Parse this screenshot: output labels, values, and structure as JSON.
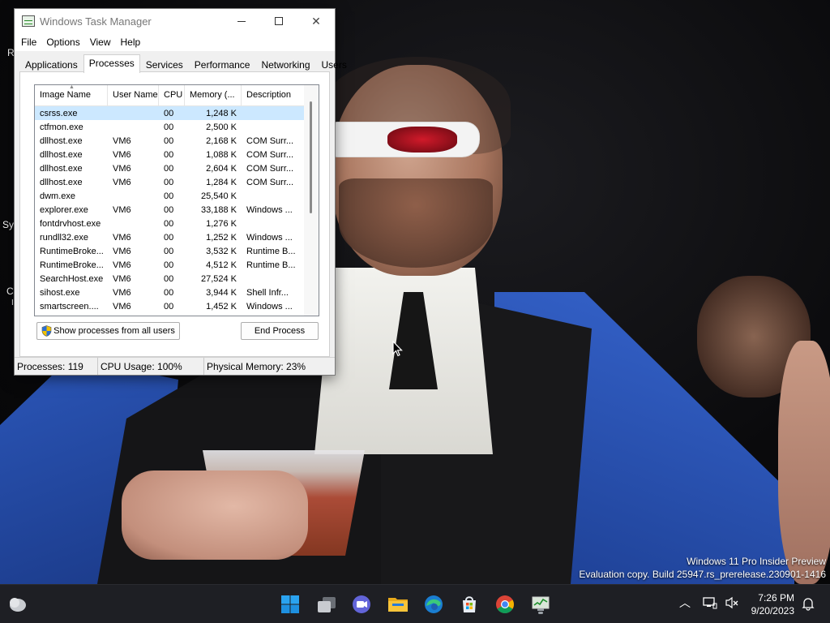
{
  "window": {
    "title": "Windows Task Manager",
    "menu": [
      "File",
      "Options",
      "View",
      "Help"
    ],
    "tabs": [
      "Applications",
      "Processes",
      "Services",
      "Performance",
      "Networking",
      "Users"
    ],
    "active_tab": "Processes"
  },
  "process_table": {
    "columns": [
      "Image Name",
      "User Name",
      "CPU",
      "Memory (...",
      "Description"
    ],
    "rows": [
      {
        "name": "csrss.exe",
        "user": "",
        "cpu": "00",
        "mem": "1,248 K",
        "desc": ""
      },
      {
        "name": "ctfmon.exe",
        "user": "",
        "cpu": "00",
        "mem": "2,500 K",
        "desc": ""
      },
      {
        "name": "dllhost.exe",
        "user": "VM6",
        "cpu": "00",
        "mem": "2,168 K",
        "desc": "COM Surr..."
      },
      {
        "name": "dllhost.exe",
        "user": "VM6",
        "cpu": "00",
        "mem": "1,088 K",
        "desc": "COM Surr..."
      },
      {
        "name": "dllhost.exe",
        "user": "VM6",
        "cpu": "00",
        "mem": "2,604 K",
        "desc": "COM Surr..."
      },
      {
        "name": "dllhost.exe",
        "user": "VM6",
        "cpu": "00",
        "mem": "1,284 K",
        "desc": "COM Surr..."
      },
      {
        "name": "dwm.exe",
        "user": "",
        "cpu": "00",
        "mem": "25,540 K",
        "desc": ""
      },
      {
        "name": "explorer.exe",
        "user": "VM6",
        "cpu": "00",
        "mem": "33,188 K",
        "desc": "Windows ..."
      },
      {
        "name": "fontdrvhost.exe",
        "user": "",
        "cpu": "00",
        "mem": "1,276 K",
        "desc": ""
      },
      {
        "name": "rundll32.exe",
        "user": "VM6",
        "cpu": "00",
        "mem": "1,252 K",
        "desc": "Windows ..."
      },
      {
        "name": "RuntimeBroke...",
        "user": "VM6",
        "cpu": "00",
        "mem": "3,532 K",
        "desc": "Runtime B..."
      },
      {
        "name": "RuntimeBroke...",
        "user": "VM6",
        "cpu": "00",
        "mem": "4,512 K",
        "desc": "Runtime B..."
      },
      {
        "name": "SearchHost.exe",
        "user": "VM6",
        "cpu": "00",
        "mem": "27,524 K",
        "desc": ""
      },
      {
        "name": "sihost.exe",
        "user": "VM6",
        "cpu": "00",
        "mem": "3,944 K",
        "desc": "Shell Infr..."
      },
      {
        "name": "smartscreen....",
        "user": "VM6",
        "cpu": "00",
        "mem": "1,452 K",
        "desc": "Windows ..."
      }
    ],
    "selected_row": "csrss.exe"
  },
  "buttons": {
    "show_all": "Show processes from all users",
    "end_process": "End Process"
  },
  "status": {
    "processes": "Processes: 119",
    "cpu": "CPU Usage: 100%",
    "memory": "Physical Memory: 23%"
  },
  "desktop": {
    "fragments": [
      "R",
      "Sys",
      "C",
      "I"
    ],
    "watermark_line1": "Windows 11 Pro Insider Preview",
    "watermark_line2": "Evaluation copy. Build 25947.rs_prerelease.230901-1416"
  },
  "taskbar": {
    "apps": [
      "start-icon",
      "task-view-icon",
      "teams-chat-icon",
      "file-explorer-icon",
      "edge-icon",
      "store-icon",
      "chrome-icon",
      "task-manager-icon"
    ],
    "time": "7:26 PM",
    "date": "9/20/2023"
  },
  "colors": {
    "selection": "#cce8ff",
    "taskbar": "#1e1f24",
    "window_bg": "#f0f0f0"
  }
}
